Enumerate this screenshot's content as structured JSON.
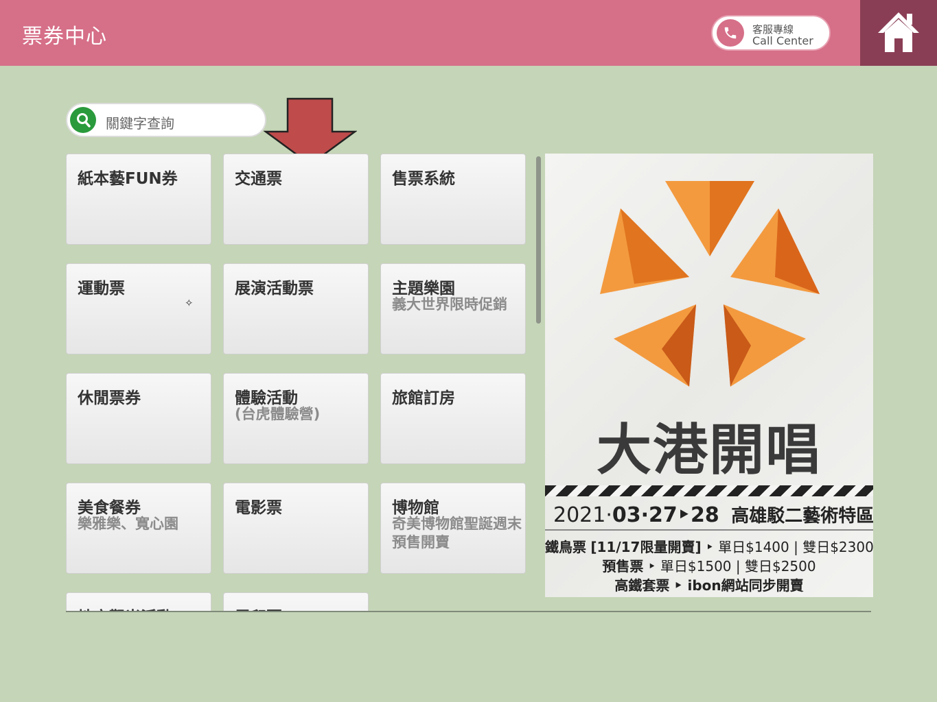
{
  "header": {
    "title": "票券中心",
    "call_center_zh": "客服專線",
    "call_center_en": "Call Center"
  },
  "search": {
    "placeholder": "關鍵字查詢"
  },
  "tiles": [
    {
      "title": "紙本藝FUN券",
      "subtitle": ""
    },
    {
      "title": "交通票",
      "subtitle": ""
    },
    {
      "title": "售票系統",
      "subtitle": ""
    },
    {
      "title": "運動票",
      "subtitle": "",
      "marker": "✧"
    },
    {
      "title": "展演活動票",
      "subtitle": ""
    },
    {
      "title": "主題樂園",
      "subtitle": "義大世界限時促銷"
    },
    {
      "title": "休閒票券",
      "subtitle": ""
    },
    {
      "title": "體驗活動",
      "subtitle": "(台虎體驗營)"
    },
    {
      "title": "旅館訂房",
      "subtitle": ""
    },
    {
      "title": "美食餐券",
      "subtitle": "樂雅樂、寬心園"
    },
    {
      "title": "電影票",
      "subtitle": ""
    },
    {
      "title": "博物館",
      "subtitle": "奇美博物館聖誕週末預售開賣"
    },
    {
      "title": "地方觀光活動",
      "subtitle": ""
    },
    {
      "title": "電印票",
      "subtitle": ""
    }
  ],
  "poster": {
    "title": "大港開唱",
    "date_year": "2021·",
    "date_days": "03·27‣28",
    "venue": "高雄駁二藝術特區",
    "row1_label": "鐵鳥票",
    "row1_bracket": "[11/17限量開賣]",
    "row1_prices": "‣ 單日$1400 | 雙日$2300",
    "row2_label": "預售票",
    "row2_prices": "‣ 單日$1500 | 雙日$2500",
    "row3_label": "高鐵套票",
    "row3_text": "‣ ibon網站同步開賣"
  },
  "colors": {
    "header_bg": "#d66f88",
    "home_bg": "#8a3e55",
    "page_bg": "#c5d5b7",
    "search_icon": "#2a9a3c",
    "arrow": "#bf4b4b",
    "poster_orange": "#f08a2c"
  },
  "icons": [
    "phone-icon",
    "home-icon",
    "search-icon",
    "down-arrow-icon"
  ]
}
